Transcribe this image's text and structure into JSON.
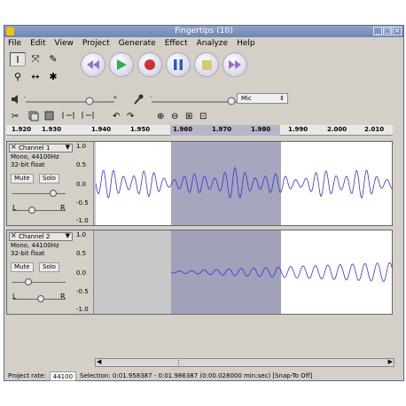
{
  "window": {
    "title": "Fingertips (10)"
  },
  "menu": [
    "File",
    "Edit",
    "View",
    "Project",
    "Generate",
    "Effect",
    "Analyze",
    "Help"
  ],
  "transport": [
    "skip-start",
    "play",
    "record",
    "pause",
    "stop",
    "skip-end"
  ],
  "meter": {
    "input_label": "Mic"
  },
  "ruler": {
    "ticks": [
      "1.920",
      "1.930",
      "1.940",
      "1.950",
      "1.960",
      "1.970",
      "1.980",
      "1.990",
      "2.000",
      "2.010"
    ]
  },
  "tracks": [
    {
      "name": "Channel 1",
      "info1": "Mono, 44100Hz",
      "info2": "32-bit float",
      "mute": "Mute",
      "solo": "Solo",
      "scale": [
        "1.0",
        "0.5",
        "0.0",
        "-0.5",
        "-1.0"
      ]
    },
    {
      "name": "Channel 2",
      "info1": "Mono, 44100Hz",
      "info2": "32-bit float",
      "mute": "Mute",
      "solo": "Solo",
      "scale": [
        "1.0",
        "0.5",
        "0.0",
        "-0.5",
        "-1.0"
      ]
    }
  ],
  "pan": {
    "left": "L",
    "right": "R"
  },
  "status": {
    "rate_label": "Project rate:",
    "rate_value": "44100",
    "selection": "Selection: 0:01.958387 - 0:01.986387 (0:00.028000 min:sec)  [Snap-To Off]"
  }
}
